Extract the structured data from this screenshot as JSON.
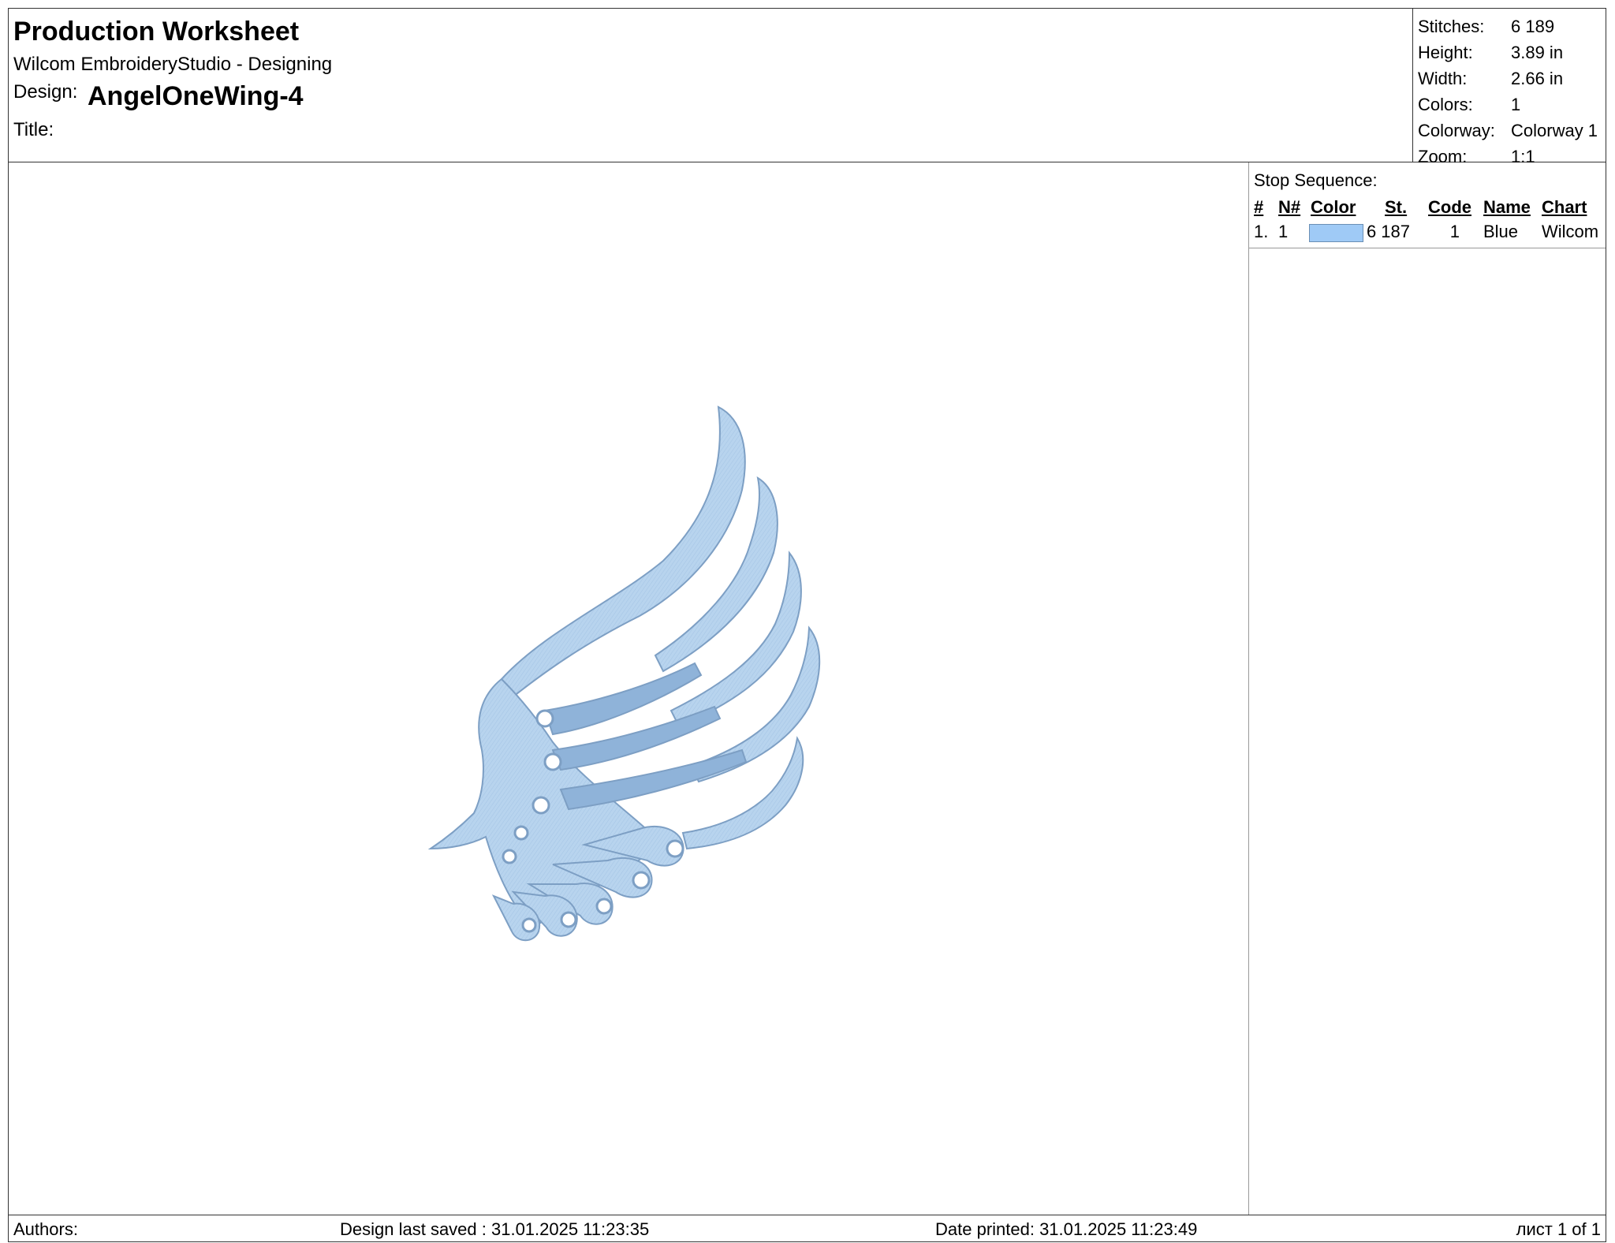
{
  "header": {
    "title": "Production Worksheet",
    "app": "Wilcom EmbroideryStudio - Designing",
    "design_label": "Design:",
    "design_name": "AngelOneWing-4",
    "title_label": "Title:"
  },
  "stats": [
    {
      "label": "Stitches:",
      "value": "6 189"
    },
    {
      "label": "Height:",
      "value": "3.89 in"
    },
    {
      "label": "Width:",
      "value": "2.66 in"
    },
    {
      "label": "Colors:",
      "value": "1"
    },
    {
      "label": "Colorway:",
      "value": "Colorway 1"
    },
    {
      "label": "Zoom:",
      "value": "1:1"
    }
  ],
  "stop_sequence": {
    "label": "Stop Sequence:",
    "columns": {
      "idx": "#",
      "n": "N#",
      "color": "Color",
      "st": "St.",
      "code": "Code",
      "name": "Name",
      "chart": "Chart"
    },
    "rows": [
      {
        "idx": "1.",
        "n": "1",
        "color": "#9fcaf6",
        "st": "6 187",
        "code": "1",
        "name": "Blue",
        "chart": "Wilcom"
      }
    ]
  },
  "design_colors": {
    "thread": "#b8d4ee",
    "thread_dark": "#8fb3d9",
    "outline": "#7d9fc4"
  },
  "footer": {
    "authors": "Authors:",
    "saved": "Design last saved : 31.01.2025 11:23:35",
    "printed": "Date printed: 31.01.2025 11:23:49",
    "page": "лист 1 of 1"
  }
}
